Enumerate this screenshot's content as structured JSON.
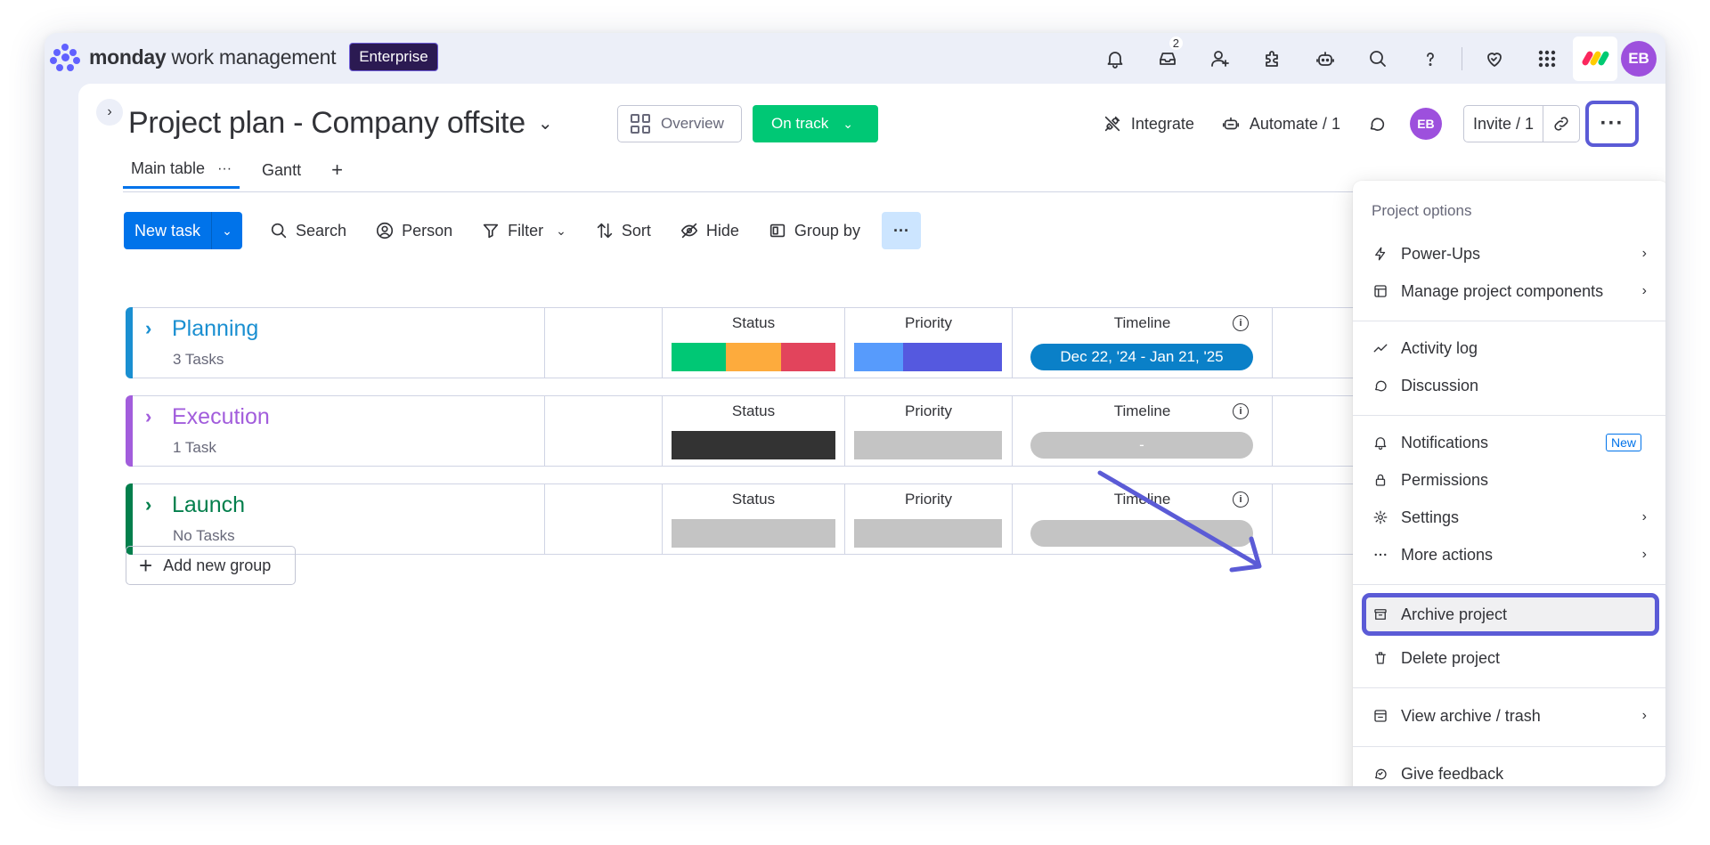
{
  "topbar": {
    "brand_bold": "monday",
    "brand_rest": " work management",
    "plan_badge": "Enterprise",
    "inbox_count": "2",
    "user_initials": "EB",
    "icons": [
      "bell-icon",
      "inbox-icon",
      "invite-user-icon",
      "apps-puzzle-icon",
      "ai-bot-icon",
      "search-icon",
      "help-icon",
      "heart-icon",
      "app-grid-icon"
    ]
  },
  "header": {
    "title": "Project plan - Company offsite",
    "overview_label": "Overview",
    "status_label": "On track",
    "integrate_label": "Integrate",
    "automate_label": "Automate / 1",
    "user_initials": "EB",
    "invite_label": "Invite / 1",
    "more_label": "···"
  },
  "tabs": [
    {
      "label": "Main table",
      "active": true
    },
    {
      "label": "Gantt",
      "active": false
    }
  ],
  "toolbar": {
    "new_task": "New task",
    "search": "Search",
    "person": "Person",
    "filter": "Filter",
    "sort": "Sort",
    "hide": "Hide",
    "group_by": "Group by"
  },
  "groups": [
    {
      "name": "Planning",
      "count": "3 Tasks",
      "color": "#1a8fd1",
      "status_header": "Status",
      "priority_header": "Priority",
      "timeline_header": "Timeline",
      "status_segments": [
        "#00c875",
        "#fdab3d",
        "#e2445c"
      ],
      "priority_segments": [
        "#579bfc",
        "#5559df",
        "#5559df"
      ],
      "timeline": "Dec 22, '24 - Jan 21, '25",
      "timeline_color": "#0a80c8"
    },
    {
      "name": "Execution",
      "count": "1 Task",
      "color": "#a25ddc",
      "status_header": "Status",
      "priority_header": "Priority",
      "timeline_header": "Timeline",
      "status_segments": [
        "#333333"
      ],
      "priority_segments": [
        "#c4c4c4"
      ],
      "timeline": "-",
      "timeline_color": "#c4c4c4"
    },
    {
      "name": "Launch",
      "count": "No Tasks",
      "color": "#037f4c",
      "status_header": "Status",
      "priority_header": "Priority",
      "timeline_header": "Timeline",
      "status_segments": [
        "#c4c4c4"
      ],
      "priority_segments": [
        "#c4c4c4"
      ],
      "timeline": "",
      "timeline_color": "#c4c4c4"
    }
  ],
  "add_group_label": "Add new group",
  "menu": {
    "title": "Project options",
    "items": [
      {
        "label": "Power-Ups",
        "icon": "bolt-icon",
        "submenu": true
      },
      {
        "label": "Manage project components",
        "icon": "components-icon",
        "submenu": true
      },
      {
        "label": "Activity log",
        "icon": "activity-icon"
      },
      {
        "label": "Discussion",
        "icon": "chat-bubble-icon"
      },
      {
        "label": "Notifications",
        "icon": "bell-icon",
        "badge": "New"
      },
      {
        "label": "Permissions",
        "icon": "lock-icon"
      },
      {
        "label": "Settings",
        "icon": "gear-icon",
        "submenu": true
      },
      {
        "label": "More actions",
        "icon": "dots-icon",
        "submenu": true
      },
      {
        "label": "Archive project",
        "icon": "archive-icon",
        "highlighted": true
      },
      {
        "label": "Delete project",
        "icon": "trash-icon"
      },
      {
        "label": "View archive / trash",
        "icon": "archive-view-icon",
        "submenu": true
      },
      {
        "label": "Give feedback",
        "icon": "feedback-icon"
      }
    ]
  },
  "colors": {
    "accent": "#0073ea",
    "highlight": "#5b5bd6",
    "on_track": "#00c875"
  }
}
